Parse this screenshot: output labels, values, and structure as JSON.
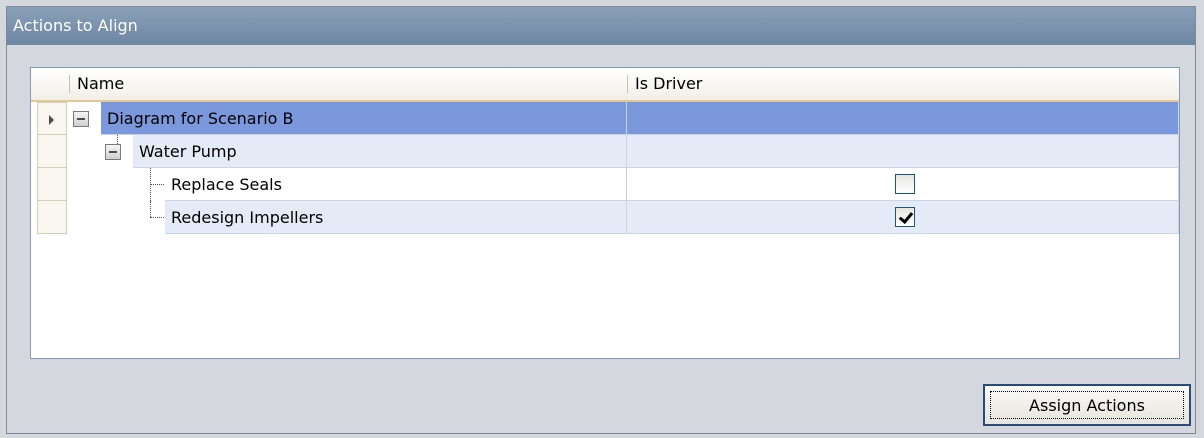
{
  "panel": {
    "title": "Actions to Align",
    "assign_label": "Assign Actions"
  },
  "grid": {
    "columns": [
      "Name",
      "Is Driver"
    ],
    "rows": [
      {
        "name": "Diagram for Scenario B",
        "is_driver": null,
        "selected": true
      },
      {
        "name": "Water Pump",
        "is_driver": null,
        "selected": false
      },
      {
        "name": "Replace Seals",
        "is_driver": false,
        "selected": false
      },
      {
        "name": "Redesign Impellers",
        "is_driver": true,
        "selected": false
      }
    ]
  },
  "colors": {
    "title_bar": "#7890ab",
    "selected_row": "#7b98dc",
    "alt_row": "#e4ebf7"
  }
}
